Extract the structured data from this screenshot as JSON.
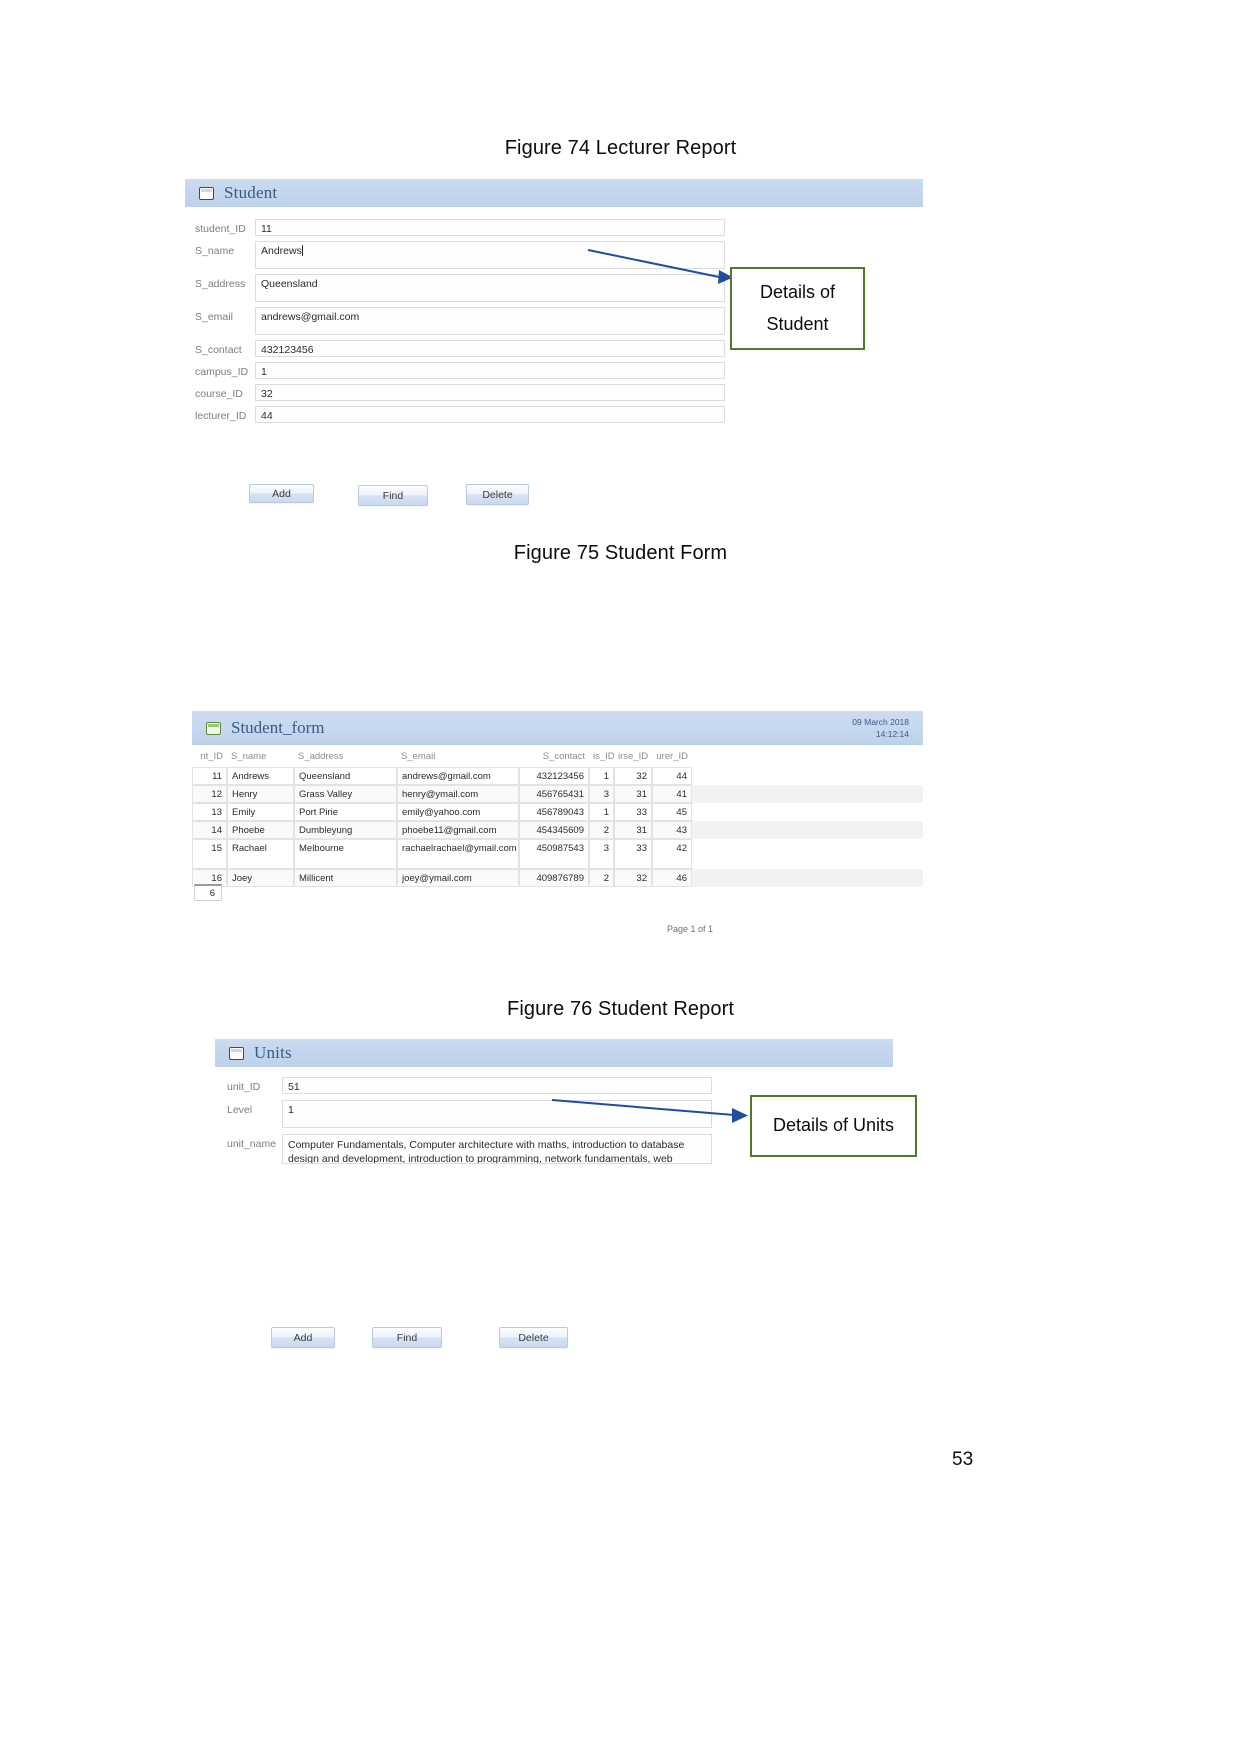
{
  "document": {
    "page_number": "53",
    "captions": {
      "fig74": "Figure 74 Lecturer Report",
      "fig75": "Figure 75 Student Form",
      "fig76": "Figure 76 Student Report"
    }
  },
  "student_form": {
    "title": "Student",
    "icon": "form-window-icon",
    "fields": [
      {
        "label": "student_ID",
        "value": "11"
      },
      {
        "label": "S_name",
        "value": "Andrews"
      },
      {
        "label": "S_address",
        "value": "Queensland"
      },
      {
        "label": "S_email",
        "value": "andrews@gmail.com"
      },
      {
        "label": "S_contact",
        "value": "432123456"
      },
      {
        "label": "campus_ID",
        "value": "1"
      },
      {
        "label": "course_ID",
        "value": "32"
      },
      {
        "label": "lecturer_ID",
        "value": "44"
      }
    ],
    "buttons": [
      {
        "label": "Add"
      },
      {
        "label": "Find"
      },
      {
        "label": "Delete"
      }
    ],
    "callout": {
      "line1": "Details of",
      "line2": "Student",
      "border_color": "#4f7a28"
    }
  },
  "student_report": {
    "title": "Student_form",
    "icon": "report-window-icon",
    "date": "09 March 2018",
    "time": "14:12:14",
    "columns": [
      "nt_ID",
      "S_name",
      "S_address",
      "S_email",
      "S_contact",
      "is_ID",
      "irse_ID",
      "urer_ID"
    ],
    "rows": [
      {
        "id": "11",
        "name": "Andrews",
        "address": "Queensland",
        "email": "andrews@gmail.com",
        "contact": "432123456",
        "campus": "1",
        "course": "32",
        "lecturer": "44"
      },
      {
        "id": "12",
        "name": "Henry",
        "address": "Grass Valley",
        "email": "henry@ymail.com",
        "contact": "456765431",
        "campus": "3",
        "course": "31",
        "lecturer": "41"
      },
      {
        "id": "13",
        "name": "Emily",
        "address": "Port Pirie",
        "email": "emily@yahoo.com",
        "contact": "456789043",
        "campus": "1",
        "course": "33",
        "lecturer": "45"
      },
      {
        "id": "14",
        "name": "Phoebe",
        "address": "Dumbleyung",
        "email": "phoebe11@gmail.com",
        "contact": "454345609",
        "campus": "2",
        "course": "31",
        "lecturer": "43"
      },
      {
        "id": "15",
        "name": "Rachael",
        "address": "Melbourne",
        "email": "rachaelrachael@ymail.com",
        "contact": "450987543",
        "campus": "3",
        "course": "33",
        "lecturer": "42"
      },
      {
        "id": "16",
        "name": "Joey",
        "address": "Millicent",
        "email": "joey@ymail.com",
        "contact": "409876789",
        "campus": "2",
        "course": "32",
        "lecturer": "46"
      }
    ],
    "record_count": "6",
    "page_footer": "Page 1 of 1"
  },
  "units_form": {
    "title": "Units",
    "icon": "form-window-icon",
    "fields": [
      {
        "label": "unit_ID",
        "value": "51"
      },
      {
        "label": "Level",
        "value": "1"
      },
      {
        "label": "unit_name",
        "value": "Computer Fundamentals, Computer architecture with maths, introduction to database design and development, introduction to programming, network fundamentals, web foundation"
      }
    ],
    "buttons": [
      {
        "label": "Add"
      },
      {
        "label": "Find"
      },
      {
        "label": "Delete"
      }
    ],
    "callout": {
      "line1": "Details of Units",
      "border_color": "#4f7a28"
    }
  }
}
